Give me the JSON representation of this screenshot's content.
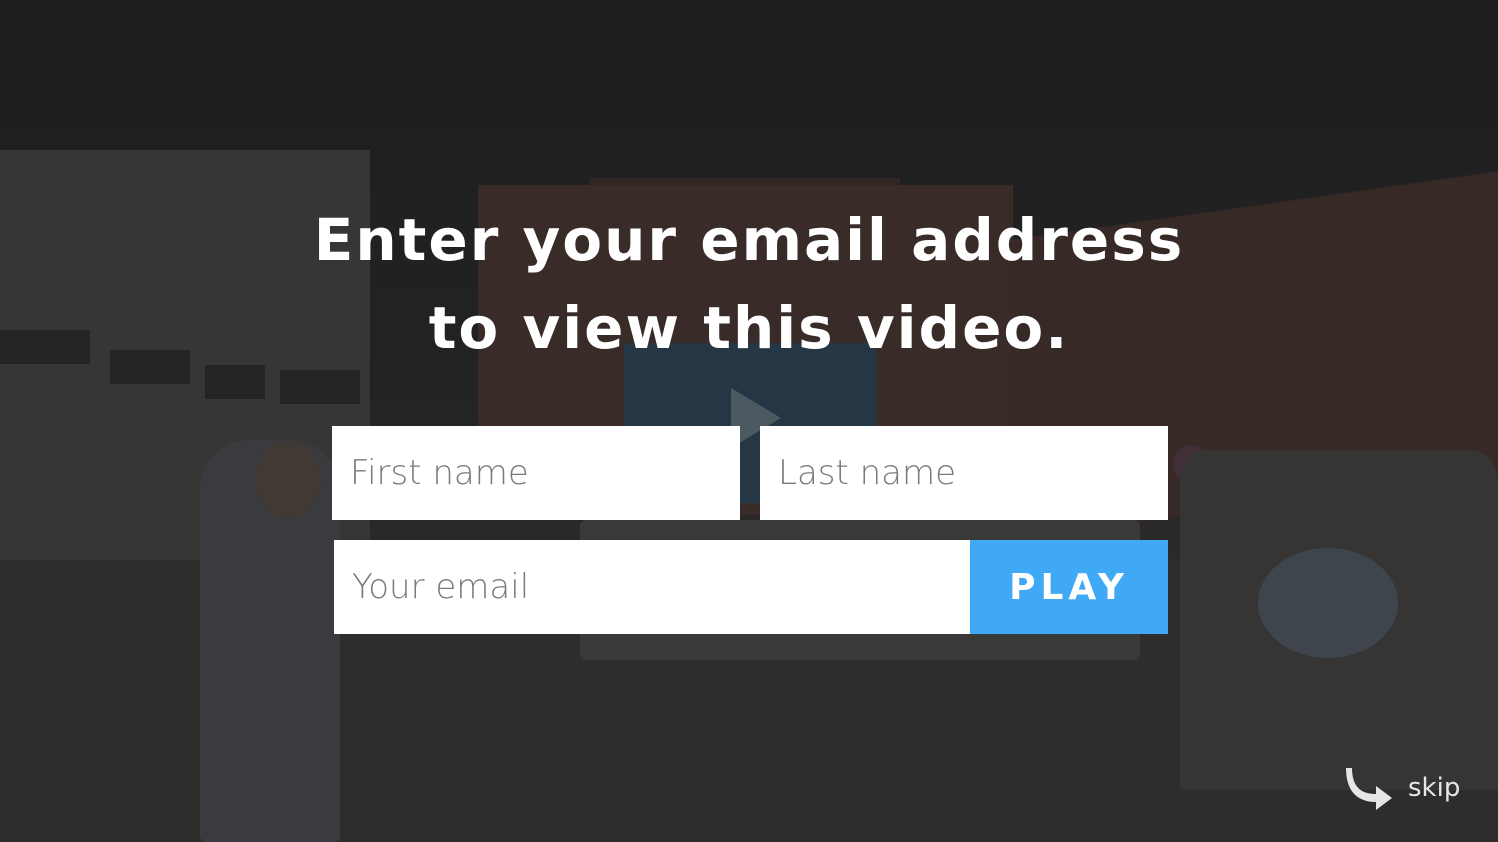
{
  "headline": {
    "line1": "Enter your email address",
    "line2": "to view this video."
  },
  "form": {
    "first_name_placeholder": "First name",
    "last_name_placeholder": "Last name",
    "email_placeholder": "Your email",
    "play_label": "PLAY"
  },
  "skip": {
    "label": "skip",
    "icon": "skip-arrow-icon"
  },
  "colors": {
    "accent": "#3fa9f5",
    "text": "#ffffff"
  }
}
